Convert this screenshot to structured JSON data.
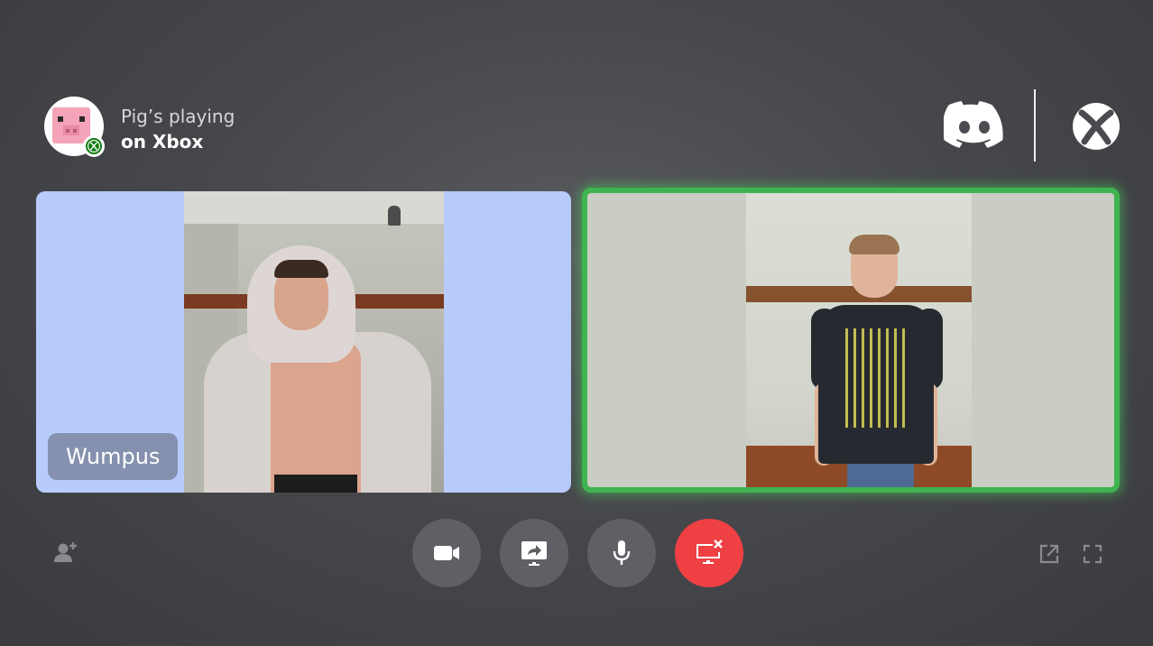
{
  "header": {
    "activity_line1": "Pig’s playing",
    "activity_line2": "on Xbox",
    "avatar_icon": "pig-avatar-icon",
    "platform_badge_icon": "xbox-icon"
  },
  "brands": {
    "left": "discord-logo-icon",
    "right": "xbox-logo-icon"
  },
  "participants": [
    {
      "name": "Wumpus",
      "speaking": false,
      "tile_color": "#b7cbfc"
    },
    {
      "name": "",
      "speaking": true,
      "speaking_ring_color": "#3fb34f"
    }
  ],
  "controls": {
    "camera_icon": "camera-icon",
    "share_icon": "screen-share-icon",
    "mic_icon": "microphone-icon",
    "disconnect_icon": "disconnect-icon",
    "disconnect_color": "#ef4044"
  },
  "side_actions": {
    "left": "add-user-icon",
    "right": [
      "popout-icon",
      "fullscreen-icon"
    ]
  }
}
